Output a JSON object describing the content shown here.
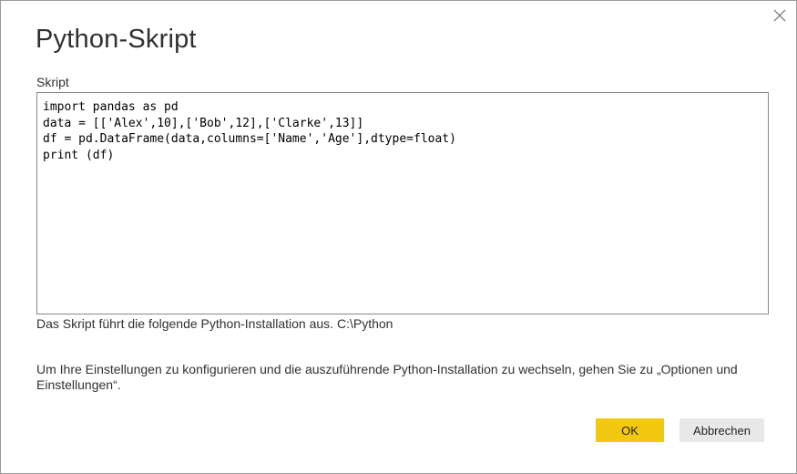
{
  "dialog": {
    "title": "Python-Skript",
    "close_icon": "close-icon",
    "script_label": "Skript",
    "script_value": "import pandas as pd\ndata = [['Alex',10],['Bob',12],['Clarke',13]]\ndf = pd.DataFrame(data,columns=['Name','Age'],dtype=float)\nprint (df)",
    "install_info": "Das Skript führt die folgende Python-Installation aus. C:\\Python",
    "hint": "Um Ihre Einstellungen zu konfigurieren und die auszuführende Python-Installation zu wechseln, gehen Sie zu „Optionen und Einstellungen“.",
    "ok_label": "OK",
    "cancel_label": "Abbrechen"
  },
  "colors": {
    "ok_button": "#f2c811",
    "cancel_button": "#e8e8e8",
    "border": "#8a8886",
    "text": "#323130"
  }
}
